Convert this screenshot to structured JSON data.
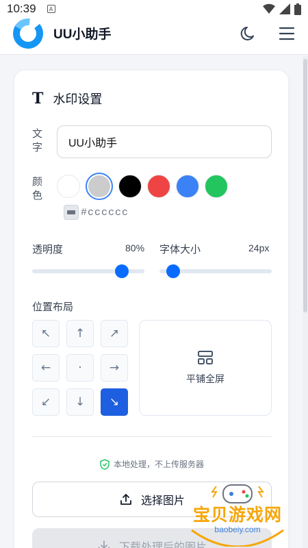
{
  "status_bar": {
    "time": "10:39",
    "notification_icon": "A"
  },
  "header": {
    "title": "UU小助手"
  },
  "watermark_settings": {
    "section_title": "水印设置",
    "text_label": "文字",
    "text_value": "UU小助手",
    "color_label": "颜色",
    "colors": [
      "#ffffff",
      "#cccccc",
      "#000000",
      "#ef4444",
      "#3b82f6",
      "#22c55e"
    ],
    "selected_color_index": 1,
    "hex_value": "#cccccc",
    "opacity": {
      "label": "透明度",
      "value_text": "80%",
      "value": 0.8
    },
    "font_size": {
      "label": "字体大小",
      "value_text": "24px",
      "value": 0.12
    },
    "position": {
      "label": "位置布局",
      "grid": [
        "↖",
        "↑",
        "↗",
        "←",
        "·",
        "→",
        "↙",
        "↓",
        "↘"
      ],
      "active_index": 8,
      "tile_label": "平铺全屏"
    },
    "privacy_note": "本地处理，不上传服务器",
    "select_button": "选择图片",
    "download_button": "下载处理后的图片"
  },
  "overlay_watermark": {
    "text": "宝贝游戏网",
    "url": "baobeiy.com"
  },
  "theme": {
    "accent": "#0a6cff",
    "active_tile": "#1d5fe0",
    "logo": "#1596f5"
  }
}
